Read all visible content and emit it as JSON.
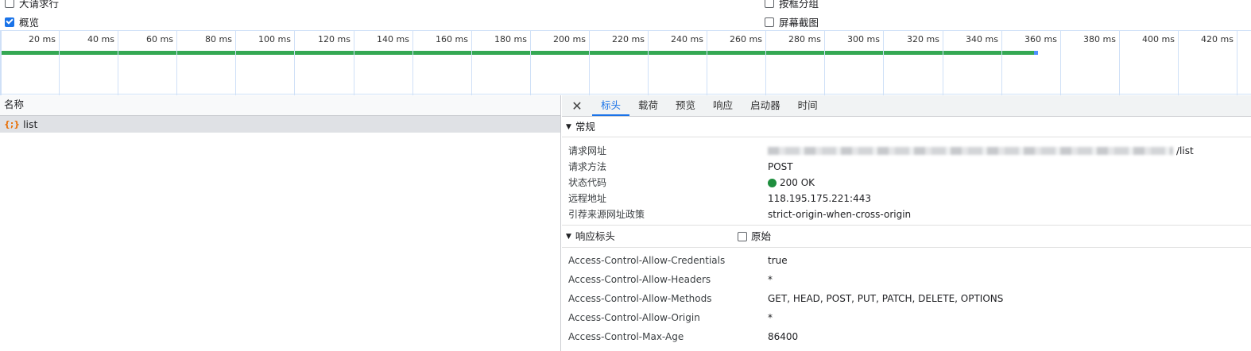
{
  "options": {
    "large_rows": "大请求行",
    "overview": "概览",
    "group_by_frame": "按框分组",
    "screenshots": "屏幕截图"
  },
  "timeline": {
    "ticks": [
      "20 ms",
      "40 ms",
      "60 ms",
      "80 ms",
      "100 ms",
      "120 ms",
      "140 ms",
      "160 ms",
      "180 ms",
      "200 ms",
      "220 ms",
      "240 ms",
      "260 ms",
      "280 ms",
      "300 ms",
      "320 ms",
      "340 ms",
      "360 ms",
      "380 ms",
      "400 ms",
      "420 ms"
    ],
    "bar_color": "#34a853",
    "bar_end_color": "#4d90fe"
  },
  "list": {
    "header": "名称",
    "rows": [
      {
        "icon": "{;}",
        "name": "list"
      }
    ]
  },
  "tabs": [
    "标头",
    "载荷",
    "预览",
    "响应",
    "启动器",
    "时间"
  ],
  "general": {
    "title": "常规",
    "rows": [
      {
        "key": "请求网址",
        "value": "/list"
      },
      {
        "key": "请求方法",
        "value": "POST"
      },
      {
        "key": "状态代码",
        "value": "200 OK"
      },
      {
        "key": "远程地址",
        "value": "118.195.175.221:443"
      },
      {
        "key": "引荐来源网址政策",
        "value": "strict-origin-when-cross-origin"
      }
    ]
  },
  "response_headers": {
    "title": "响应标头",
    "raw_label": "原始",
    "rows": [
      {
        "key": "Access-Control-Allow-Credentials",
        "value": "true"
      },
      {
        "key": "Access-Control-Allow-Headers",
        "value": "*"
      },
      {
        "key": "Access-Control-Allow-Methods",
        "value": "GET, HEAD, POST, PUT, PATCH, DELETE, OPTIONS"
      },
      {
        "key": "Access-Control-Allow-Origin",
        "value": "*"
      },
      {
        "key": "Access-Control-Max-Age",
        "value": "86400"
      }
    ]
  }
}
